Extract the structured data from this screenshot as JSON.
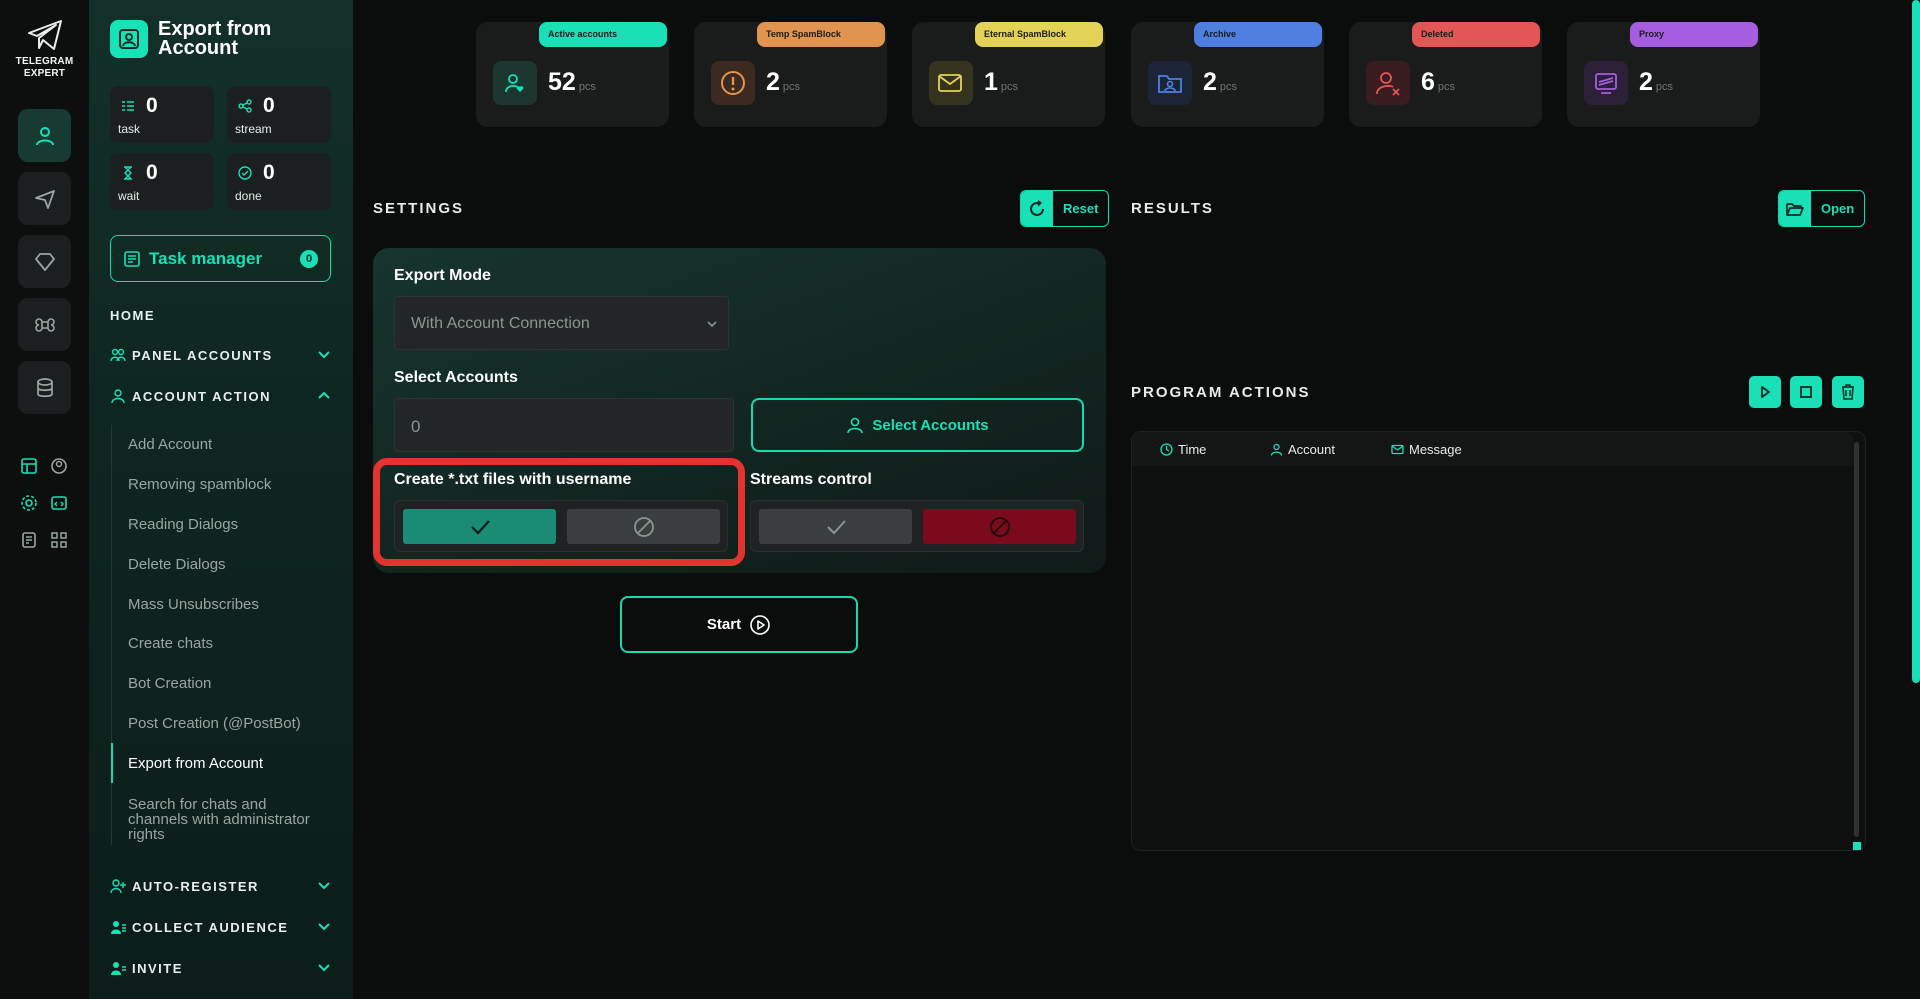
{
  "brand": {
    "line1": "TELEGRAM",
    "line2": "EXPERT"
  },
  "sidebar": {
    "title": "Export from Account",
    "stats": [
      {
        "value": "0",
        "label": "task"
      },
      {
        "value": "0",
        "label": "stream"
      },
      {
        "value": "0",
        "label": "wait"
      },
      {
        "value": "0",
        "label": "done"
      }
    ],
    "task_manager": {
      "label": "Task manager",
      "count": "0"
    },
    "home": "HOME",
    "sections": [
      {
        "label": "PANEL ACCOUNTS",
        "icon": "users-icon",
        "expanded": false
      },
      {
        "label": "ACCOUNT ACTION",
        "icon": "user-icon",
        "expanded": true
      },
      {
        "label": "AUTO-REGISTER",
        "icon": "user-plus-icon",
        "expanded": false
      },
      {
        "label": "COLLECT AUDIENCE",
        "icon": "user-list-icon",
        "expanded": false
      },
      {
        "label": "INVITE",
        "icon": "user-invite-icon",
        "expanded": false
      }
    ],
    "subitems": [
      "Add Account",
      "Removing spamblock",
      "Reading Dialogs",
      "Delete Dialogs",
      "Mass Unsubscribes",
      "Create chats",
      "Bot Creation",
      "Post Creation (@PostBot)",
      "Export from Account",
      "Search for chats and channels with administrator rights"
    ],
    "active_subitem": "Export from Account"
  },
  "kpis": [
    {
      "label": "Active accounts",
      "value": "52",
      "unit": "pcs",
      "color": "#19e0b6",
      "icon": "user-heart-icon"
    },
    {
      "label": "Temp SpamBlock",
      "value": "2",
      "unit": "pcs",
      "color": "#e0944f",
      "icon": "alert-circle-icon"
    },
    {
      "label": "Eternal SpamBlock",
      "value": "1",
      "unit": "pcs",
      "color": "#e2d357",
      "icon": "mail-block-icon"
    },
    {
      "label": "Archive",
      "value": "2",
      "unit": "pcs",
      "color": "#4e7fe0",
      "icon": "folder-user-icon"
    },
    {
      "label": "Deleted",
      "value": "6",
      "unit": "pcs",
      "color": "#e35656",
      "icon": "user-x-icon"
    },
    {
      "label": "Proxy",
      "value": "2",
      "unit": "pcs",
      "color": "#a65de0",
      "icon": "proxy-icon"
    }
  ],
  "settings": {
    "title": "SETTINGS",
    "reset_label": "Reset",
    "export_mode": {
      "label": "Export Mode",
      "value": "With Account Connection"
    },
    "select_accounts": {
      "label": "Select Accounts",
      "value": "0",
      "button": "Select Accounts"
    },
    "txt_files": {
      "label": "Create *.txt files with username",
      "enabled": true
    },
    "streams": {
      "label": "Streams control",
      "enabled": false
    },
    "start_label": "Start"
  },
  "results": {
    "title": "RESULTS",
    "open_label": "Open"
  },
  "actions": {
    "title": "PROGRAM ACTIONS",
    "columns": [
      "Time",
      "Account",
      "Message"
    ]
  },
  "colors": {
    "accent": "#19e0b6",
    "danger": "#7a0a1c",
    "highlight": "#e3332f"
  }
}
